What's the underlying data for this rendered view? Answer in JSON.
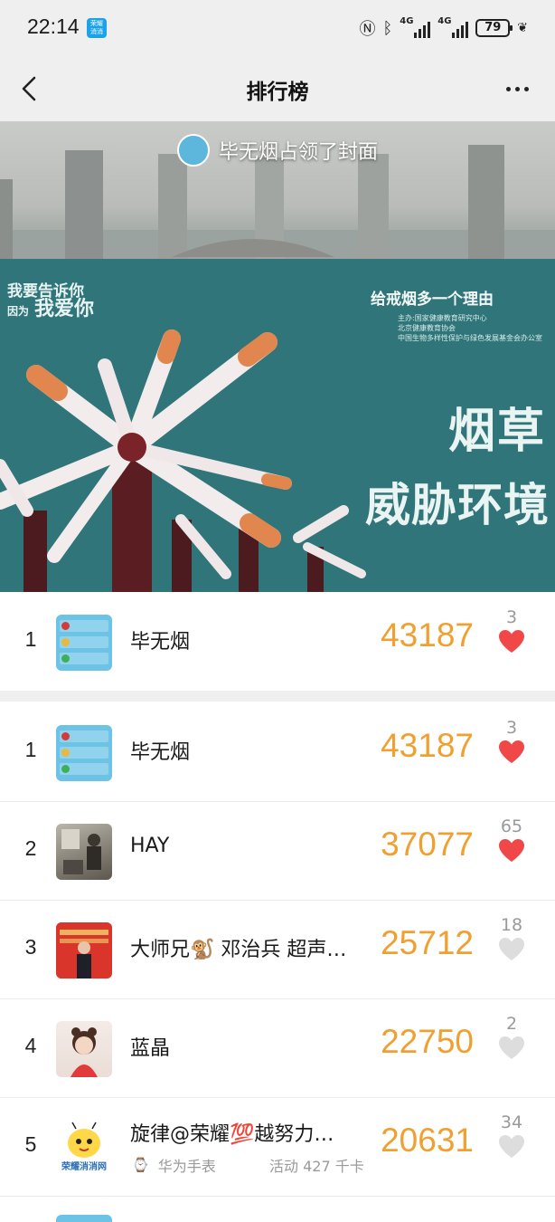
{
  "status_bar": {
    "time": "22:14",
    "app_badge_line1": "荣耀",
    "app_badge_line2": "消消",
    "network_label_1": "4G",
    "network_label_2": "4G",
    "battery": "79"
  },
  "nav": {
    "title": "排行榜",
    "back_icon": "chevron-left-icon",
    "more_icon": "more-dots-icon"
  },
  "cover": {
    "banner_text": "毕无烟占领了封面",
    "slogan_line1": "我要告诉你",
    "slogan_line2": "我爱你",
    "slogan_prefix": "因为",
    "headline": "给戒烟多一个理由",
    "sub_lines": [
      "主办:国家健康教育研究中心",
      "北京健康教育协会",
      "中国生物多样性保护与绿色发展基金会办公室"
    ],
    "big_line1": "烟草",
    "big_line2": "威胁环境"
  },
  "my_rank": {
    "rank": "1",
    "name": "毕无烟",
    "steps": "43187",
    "likes": "3",
    "liked": true
  },
  "rankings": [
    {
      "rank": "1",
      "name": "毕无烟",
      "steps": "43187",
      "likes": "3",
      "liked": true
    },
    {
      "rank": "2",
      "name": "HAY",
      "steps": "37077",
      "likes": "65",
      "liked": true
    },
    {
      "rank": "3",
      "name": "大师兄🐒 邓治兵  超声…",
      "steps": "25712",
      "likes": "18",
      "liked": false
    },
    {
      "rank": "4",
      "name": "蓝晶",
      "steps": "22750",
      "likes": "2",
      "liked": false
    },
    {
      "rank": "5",
      "name": "旋律@荣耀💯越努力…",
      "steps": "20631",
      "likes": "34",
      "liked": false,
      "device": "华为手表",
      "activity": "活动 427 千卡",
      "avatar_caption": "荣耀消消网"
    }
  ],
  "colors": {
    "steps": "#f0a030",
    "heart_liked": "#f04848",
    "heart_unliked": "#dddddd",
    "header_bg": "#efefef"
  }
}
